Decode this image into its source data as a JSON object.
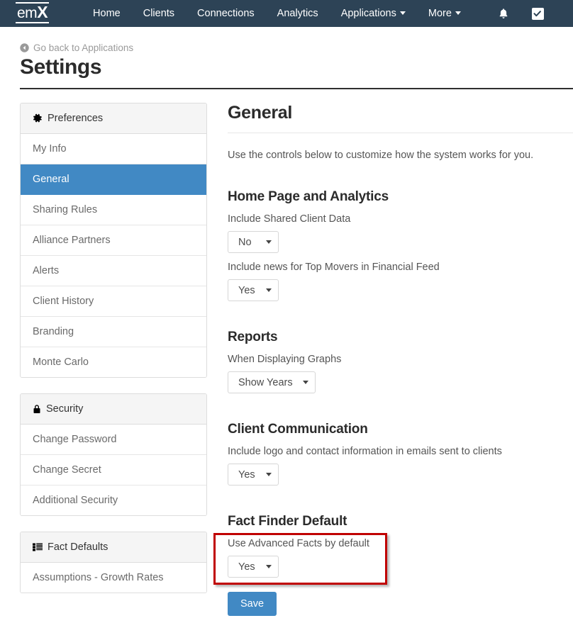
{
  "navbar": {
    "brand_prefix": "em",
    "brand_suffix": "X",
    "links": [
      {
        "label": "Home",
        "caret": false
      },
      {
        "label": "Clients",
        "caret": false
      },
      {
        "label": "Connections",
        "caret": false
      },
      {
        "label": "Analytics",
        "caret": false
      },
      {
        "label": "Applications",
        "caret": true
      },
      {
        "label": "More",
        "caret": true
      }
    ],
    "bell_icon": "bell-icon",
    "checkbox_icon": "checkbox-checked-icon",
    "background_color": "#2d4356"
  },
  "header": {
    "back_link": "Go back to Applications",
    "back_icon": "arrow-circle-left-icon",
    "title": "Settings"
  },
  "sidebar": {
    "groups": [
      {
        "heading": "Preferences",
        "icon": "gear-icon",
        "items": [
          {
            "label": "My Info",
            "active": false
          },
          {
            "label": "General",
            "active": true
          },
          {
            "label": "Sharing Rules",
            "active": false
          },
          {
            "label": "Alliance Partners",
            "active": false
          },
          {
            "label": "Alerts",
            "active": false
          },
          {
            "label": "Client History",
            "active": false
          },
          {
            "label": "Branding",
            "active": false
          },
          {
            "label": "Monte Carlo",
            "active": false
          }
        ]
      },
      {
        "heading": "Security",
        "icon": "lock-icon",
        "items": [
          {
            "label": "Change Password",
            "active": false
          },
          {
            "label": "Change Secret",
            "active": false
          },
          {
            "label": "Additional Security",
            "active": false
          }
        ]
      },
      {
        "heading": "Fact Defaults",
        "icon": "list-icon",
        "items": [
          {
            "label": "Assumptions - Growth Rates",
            "active": false
          }
        ]
      }
    ]
  },
  "main": {
    "title": "General",
    "intro": "Use the controls below to customize how the system works for you.",
    "sections": [
      {
        "title": "Home Page and Analytics",
        "fields": [
          {
            "label": "Include Shared Client Data",
            "value": "No"
          },
          {
            "label": "Include news for Top Movers in Financial Feed",
            "value": "Yes"
          }
        ]
      },
      {
        "title": "Reports",
        "fields": [
          {
            "label": "When Displaying Graphs",
            "value": "Show Years"
          }
        ]
      },
      {
        "title": "Client Communication",
        "fields": [
          {
            "label": "Include logo and contact information in emails sent to clients",
            "value": "Yes"
          }
        ]
      },
      {
        "title": "Fact Finder Default",
        "fields": [
          {
            "label": "Use Advanced Facts by default",
            "value": "Yes"
          }
        ]
      }
    ],
    "save_label": "Save"
  },
  "annotation": {
    "color": "#c00000"
  },
  "colors": {
    "accent_blue": "#4189c4",
    "navbar": "#2d4356",
    "annotation_red": "#c00000"
  }
}
